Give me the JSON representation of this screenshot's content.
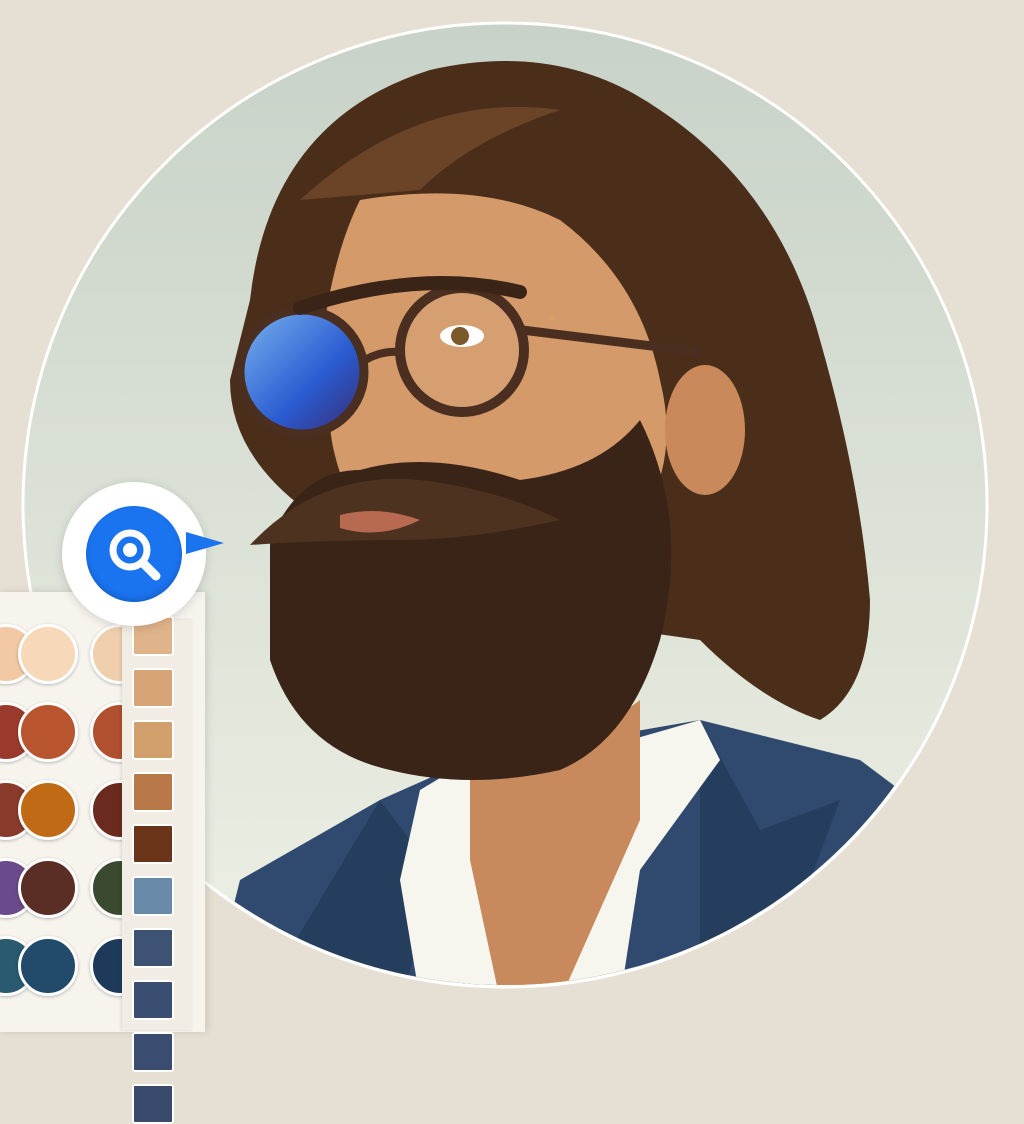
{
  "colors": {
    "background": "#e6e0d4",
    "circle_top": "#c8d2c8",
    "circle_bottom": "#eef0e4",
    "accent": "#1a73ef",
    "suit": "#2f4a6e",
    "shirt": "#f6f6ee",
    "hair": "#4a2e1a",
    "skin": "#d49a6a"
  },
  "icons": {
    "eyedropper": "magnifier-search-icon",
    "pointer": "triangle-pointer-icon"
  },
  "palette": {
    "circle_swatches": [
      "#f2c9a4",
      "#f7d8b8",
      "#f0cfae",
      "#9a3a2c",
      "#b8552e",
      "#b0502e",
      "#8a3a2a",
      "#c06a16",
      "#6a2a1e",
      "#6a4a8a",
      "#5a2e24",
      "#3a4a30",
      "#2a5a70",
      "#224a6a",
      "#1e3a5a"
    ],
    "strip_swatches": [
      "#e0b48a",
      "#d6a476",
      "#d2a06c",
      "#b8784a",
      "#6a3418",
      "#6a8aaa",
      "#3e5274",
      "#3a4e72",
      "#3a4c70",
      "#3a4a6c"
    ]
  }
}
